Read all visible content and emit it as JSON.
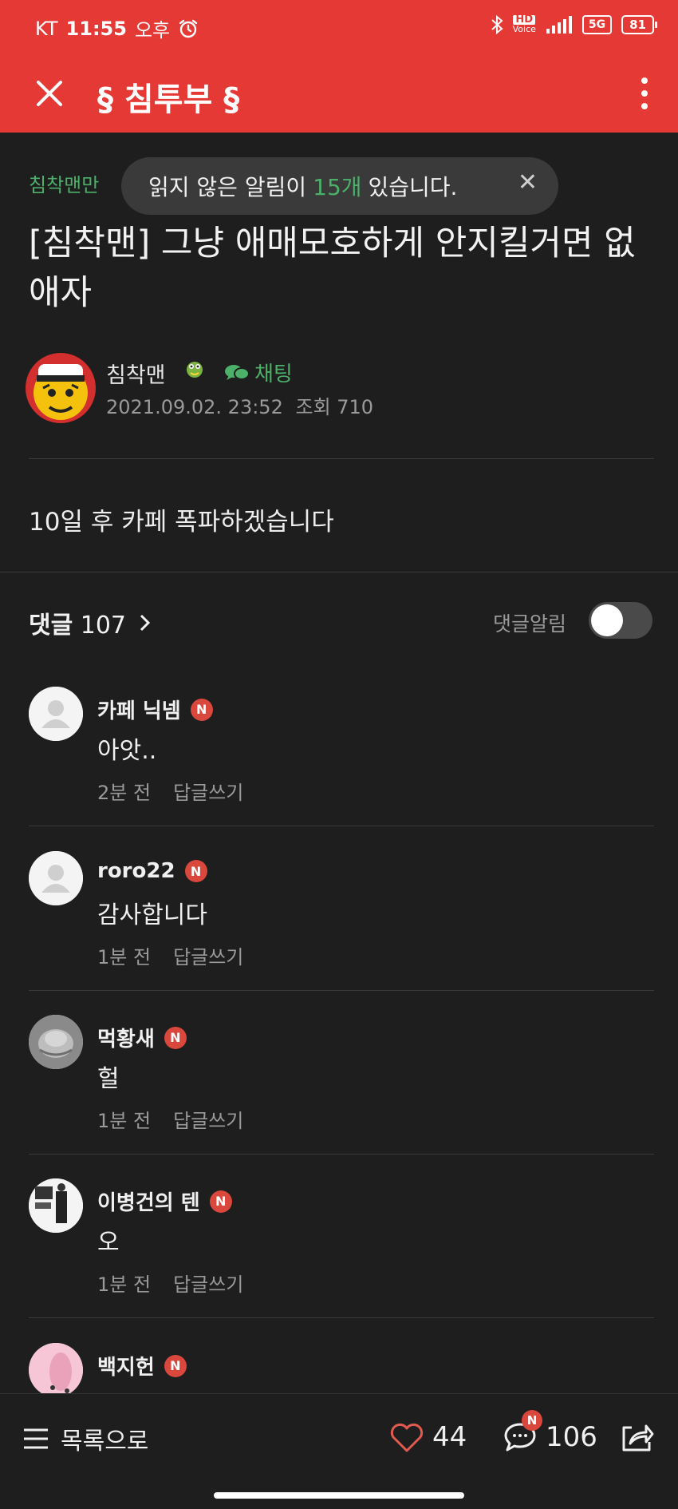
{
  "status_bar": {
    "carrier": "KT",
    "time": "11:55",
    "ampm": "오후",
    "hd_label": "HD",
    "voice_label": "Voice",
    "network": "5G",
    "battery": "81"
  },
  "app_bar": {
    "title": "§ 침투부 §"
  },
  "toast": {
    "prefix": "읽지 않은 알림이",
    "count": "15개",
    "suffix": "있습니다."
  },
  "post": {
    "board": "침착맨만",
    "title": "[침착맨] 그냥 애매모호하게 안지킬거면 없애자",
    "author": "침착맨",
    "chat_label": "채팅",
    "date": "2021.09.02. 23:52",
    "views_label": "조회 710",
    "body": "10일 후 카페 폭파하겠습니다"
  },
  "comments_header": {
    "label": "댓글",
    "count": "107",
    "notify_label": "댓글알림",
    "notify_on": false
  },
  "comments": [
    {
      "name": "카페 닉넴",
      "badge": "N",
      "text": "아앗..",
      "time": "2분 전",
      "reply": "답글쓰기",
      "avatar": "default-avatar"
    },
    {
      "name": "roro22",
      "badge": "N",
      "text": "감사합니다",
      "time": "1분 전",
      "reply": "답글쓰기",
      "avatar": "default-avatar"
    },
    {
      "name": "먹황새",
      "badge": "N",
      "text": "헐",
      "time": "1분 전",
      "reply": "답글쓰기",
      "avatar": "photo-avatar"
    },
    {
      "name": "이병건의 텐",
      "badge": "N",
      "text": "오",
      "time": "1분 전",
      "reply": "답글쓰기",
      "avatar": "photo-avatar"
    },
    {
      "name": "백지헌",
      "badge": "N",
      "text": "",
      "time": "",
      "reply": "",
      "avatar": "photo-avatar"
    }
  ],
  "bottom_bar": {
    "list_label": "목록으로",
    "likes": "44",
    "comments": "106",
    "comment_badge": "N"
  },
  "colors": {
    "primary_red": "#e53935",
    "accent_green": "#4caf6a",
    "background": "#1e1e1e",
    "badge_red": "#d9473d"
  }
}
